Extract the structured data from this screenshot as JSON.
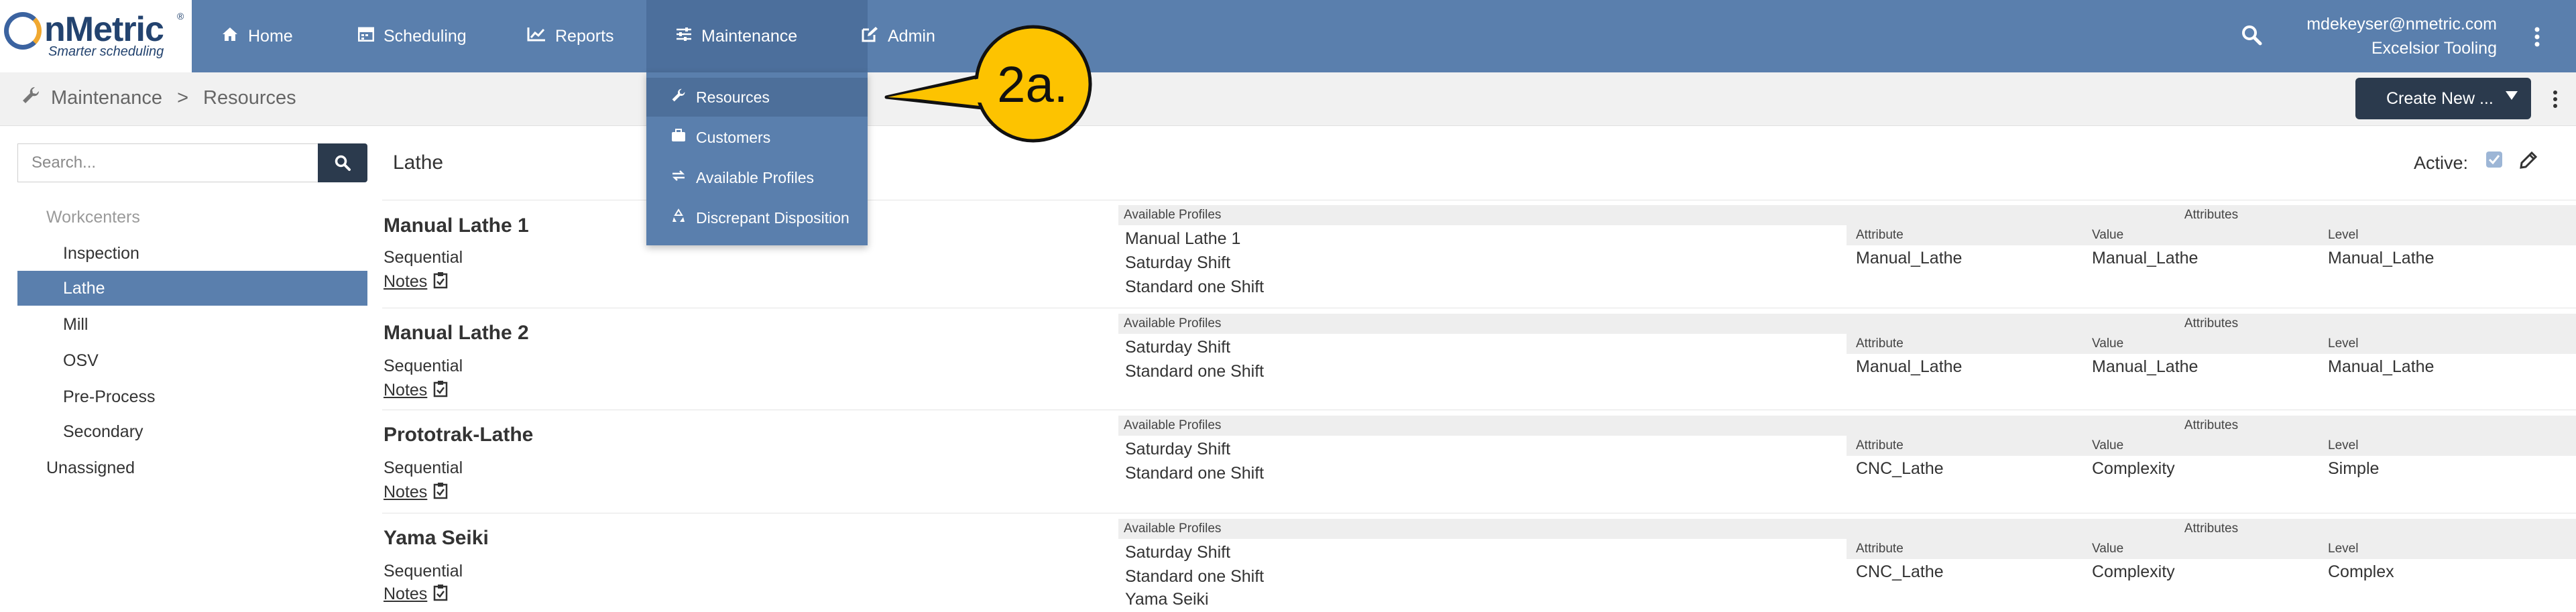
{
  "app": {
    "logo_name": "nMetric",
    "logo_tagline": "Smarter scheduling",
    "logo_reg": "®"
  },
  "nav": {
    "items": [
      {
        "label": "Home",
        "icon": "home-icon"
      },
      {
        "label": "Scheduling",
        "icon": "calendar-icon"
      },
      {
        "label": "Reports",
        "icon": "chart-icon"
      },
      {
        "label": "Maintenance",
        "icon": "sliders-icon",
        "active": true
      },
      {
        "label": "Admin",
        "icon": "edit-icon"
      }
    ],
    "user_email": "mdekeyser@nmetric.com",
    "user_org": "Excelsior Tooling"
  },
  "maintenance_menu": {
    "items": [
      {
        "label": "Resources",
        "icon": "wrench-icon",
        "hovered": true
      },
      {
        "label": "Customers",
        "icon": "briefcase-icon"
      },
      {
        "label": "Available Profiles",
        "icon": "exchange-icon"
      },
      {
        "label": "Discrepant Disposition",
        "icon": "recycle-icon"
      }
    ]
  },
  "breadcrumb": {
    "parts": [
      "Maintenance",
      "Resources"
    ],
    "separator": ">"
  },
  "toolbar": {
    "create_label": "Create New ..."
  },
  "sidebar": {
    "search_placeholder": "Search...",
    "group_label": "Workcenters",
    "items": [
      "Inspection",
      "Lathe",
      "Mill",
      "OSV",
      "Pre-Process",
      "Secondary"
    ],
    "selected": "Lathe",
    "unassigned_label": "Unassigned"
  },
  "main": {
    "title": "Lathe",
    "active_label": "Active:",
    "active_checked": true,
    "profiles_header": "Available Profiles",
    "attributes_header": "Attributes",
    "attr_columns": [
      "Attribute",
      "Value",
      "Level"
    ],
    "notes_label": "Notes",
    "resources": [
      {
        "name": "Manual Lathe 1",
        "type": "Sequential",
        "profiles": [
          "Manual Lathe 1",
          "Saturday Shift",
          "Standard one Shift"
        ],
        "attributes": [
          {
            "attribute": "Manual_Lathe",
            "value": "Manual_Lathe",
            "level": "Manual_Lathe"
          }
        ]
      },
      {
        "name": "Manual Lathe 2",
        "type": "Sequential",
        "profiles": [
          "Saturday Shift",
          "Standard one Shift"
        ],
        "attributes": [
          {
            "attribute": "Manual_Lathe",
            "value": "Manual_Lathe",
            "level": "Manual_Lathe"
          }
        ]
      },
      {
        "name": "Prototrak-Lathe",
        "type": "Sequential",
        "profiles": [
          "Saturday Shift",
          "Standard one Shift"
        ],
        "attributes": [
          {
            "attribute": "CNC_Lathe",
            "value": "Complexity",
            "level": "Simple"
          }
        ]
      },
      {
        "name": "Yama Seiki",
        "type": "Sequential",
        "profiles": [
          "Saturday Shift",
          "Standard one Shift",
          "Yama Seiki"
        ],
        "attributes": [
          {
            "attribute": "CNC_Lathe",
            "value": "Complexity",
            "level": "Complex"
          }
        ]
      }
    ]
  },
  "callout": {
    "label": "2a.",
    "fill": "#fdc300"
  },
  "colors": {
    "nav_bg": "#5a7fad",
    "dark_button": "#2b3a4d",
    "selected_bg": "#5a7fad"
  }
}
